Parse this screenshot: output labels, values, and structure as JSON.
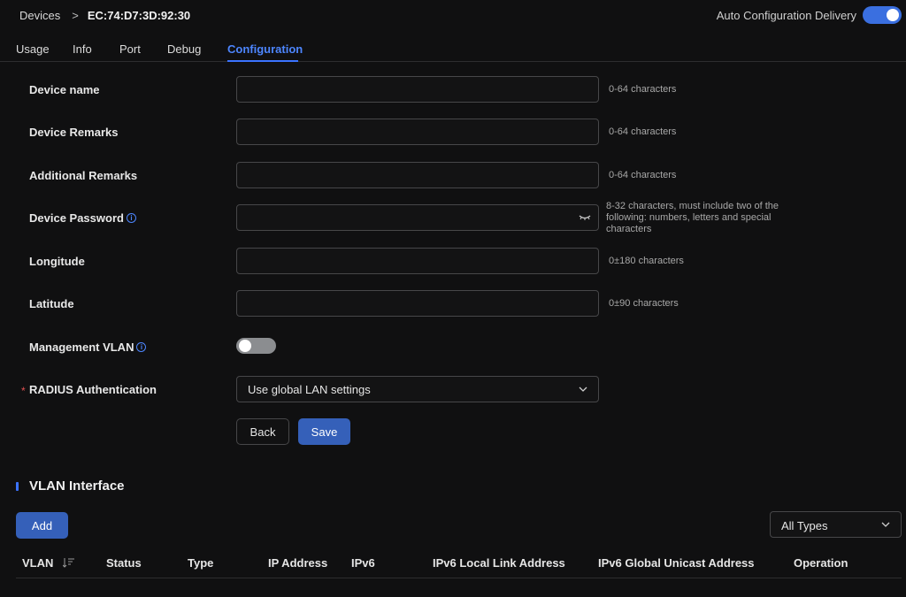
{
  "header": {
    "breadcrumb_root": "Devices",
    "breadcrumb_sep": ">",
    "device_mac": "EC:74:D7:3D:92:30",
    "auto_config_label": "Auto Configuration Delivery",
    "auto_config_enabled": true
  },
  "tabs": [
    {
      "label": "Usage"
    },
    {
      "label": "Info"
    },
    {
      "label": "Port"
    },
    {
      "label": "Debug"
    },
    {
      "label": "Configuration",
      "active": true
    }
  ],
  "form": {
    "device_name": {
      "label": "Device name",
      "value": "",
      "hint": "0-64 characters"
    },
    "device_remarks": {
      "label": "Device Remarks",
      "value": "",
      "hint": "0-64 characters"
    },
    "additional_remarks": {
      "label": "Additional Remarks",
      "value": "",
      "hint": "0-64 characters"
    },
    "device_password": {
      "label": "Device Password",
      "value": "",
      "hint": "8-32 characters, must include two of the following: numbers, letters and special characters"
    },
    "longitude": {
      "label": "Longitude",
      "value": "",
      "hint": "0±180 characters"
    },
    "latitude": {
      "label": "Latitude",
      "value": "",
      "hint": "0±90 characters"
    },
    "management_vlan": {
      "label": "Management VLAN",
      "enabled": false
    },
    "radius": {
      "label": "RADIUS Authentication",
      "required_mark": "*",
      "selected": "Use global LAN settings"
    },
    "back_label": "Back",
    "save_label": "Save"
  },
  "vlan_section": {
    "title": "VLAN Interface",
    "add_label": "Add",
    "type_filter": "All Types",
    "columns": [
      "VLAN",
      "Status",
      "Type",
      "IP Address",
      "IPv6",
      "IPv6 Local Link Address",
      "IPv6 Global Unicast Address",
      "Operation"
    ]
  },
  "colors": {
    "accent": "#3b73ff",
    "primary_button": "#3560b9",
    "background": "#101011",
    "required": "#e05252"
  }
}
